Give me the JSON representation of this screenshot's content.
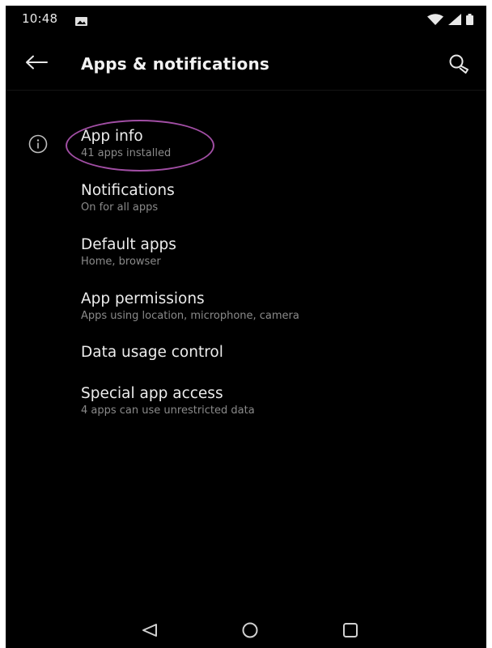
{
  "status_bar": {
    "time": "10:48",
    "icons": [
      "gallery-notification-icon",
      "wifi-icon",
      "cellular-signal-icon",
      "battery-icon"
    ]
  },
  "app_bar": {
    "title": "Apps & notifications",
    "back_icon": "arrow-left-icon",
    "search_icon": "search-icon"
  },
  "list": {
    "items": [
      {
        "title": "App info",
        "subtitle": "41 apps installed",
        "icon": "info-icon",
        "highlighted": true
      },
      {
        "title": "Notifications",
        "subtitle": "On for all apps"
      },
      {
        "title": "Default apps",
        "subtitle": "Home, browser"
      },
      {
        "title": "App permissions",
        "subtitle": "Apps using location, microphone, camera"
      },
      {
        "title": "Data usage control",
        "subtitle": ""
      },
      {
        "title": "Special app access",
        "subtitle": "4 apps can use unrestricted data"
      }
    ]
  },
  "nav_bar": {
    "buttons": [
      "back-triangle-icon",
      "home-circle-icon",
      "recents-square-icon"
    ]
  },
  "colors": {
    "background": "#000000",
    "primary_text": "#ececec",
    "secondary_text": "#8a8a8a",
    "highlight": "#a14ea4"
  }
}
